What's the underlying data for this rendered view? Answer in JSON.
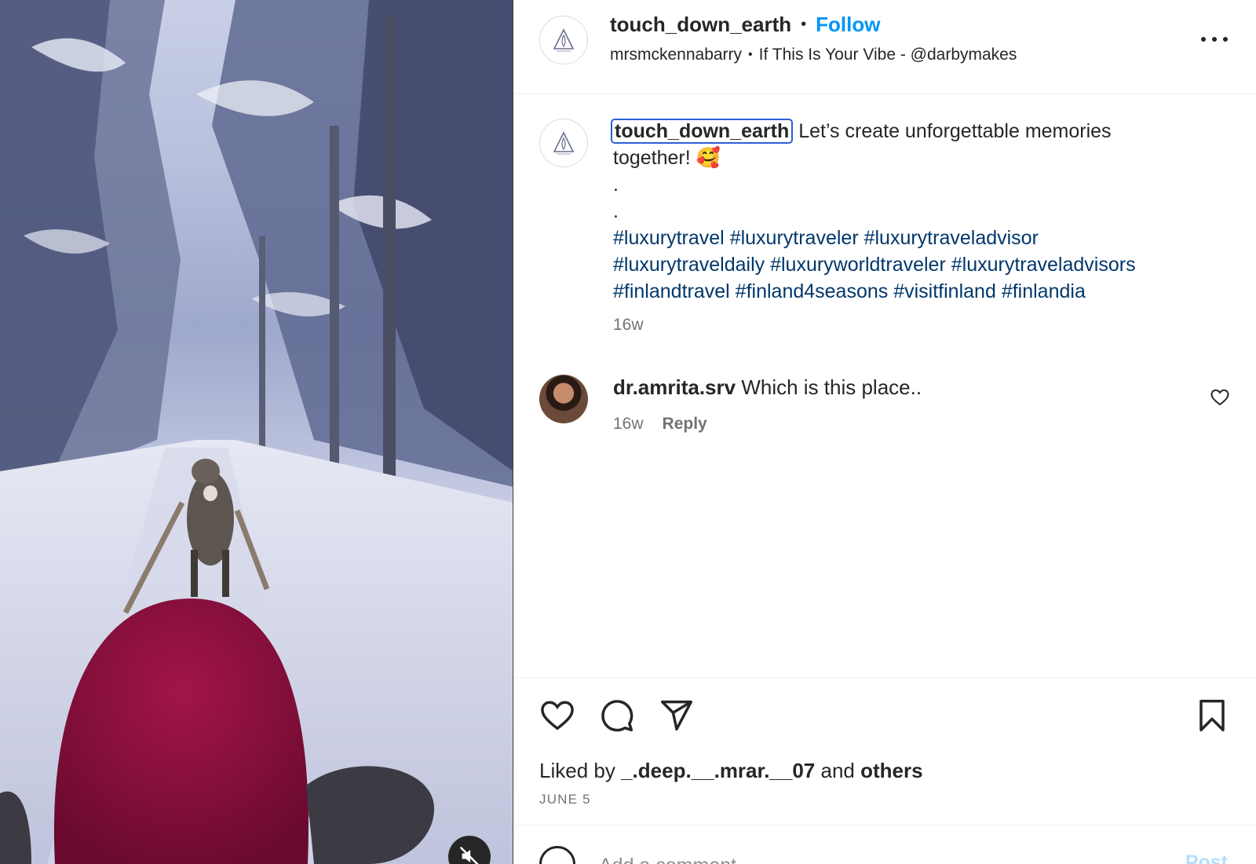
{
  "header": {
    "username": "touch_down_earth",
    "separator": "•",
    "follow_label": "Follow",
    "audio_user": "mrsmckennabarry",
    "audio_separator": "•",
    "audio_track": "If This Is Your Vibe - @darbymakes",
    "avatar_icon": "triangle-logo-icon",
    "more_icon": "more-options-icon"
  },
  "caption": {
    "username": "touch_down_earth",
    "text_line1": " Let’s create unforgettable memories",
    "text_line2": "together! 🥰",
    "dot1": ".",
    "dot2": ".",
    "hashtags": [
      "#luxurytravel",
      "#luxurytraveler",
      "#luxurytraveladvisor",
      "#luxurytraveldaily",
      "#luxuryworldtraveler",
      "#luxurytraveladvisors",
      "#finlandtravel",
      "#finland4seasons",
      "#visitfinland",
      "#finlandia"
    ],
    "time": "16w"
  },
  "comment": {
    "username": "dr.amrita.srv",
    "text": "Which is this place..",
    "time": "16w",
    "reply_label": "Reply",
    "like_icon": "heart-icon"
  },
  "actions": {
    "like_icon": "heart-icon",
    "comment_icon": "comment-bubble-icon",
    "share_icon": "paper-plane-icon",
    "save_icon": "bookmark-icon"
  },
  "likes": {
    "prefix": "Liked by",
    "user": "_.deep.__.mrar.__07",
    "middle": "and",
    "others": "others"
  },
  "post_date": "JUNE 5",
  "add_comment": {
    "placeholder": "Add a comment...",
    "post_label": "Post",
    "emoji_icon": "emoji-icon"
  },
  "media": {
    "mute_icon": "muted-speaker-icon"
  },
  "colors": {
    "accent": "#0095f6",
    "hashtag": "#00376b",
    "text": "#262626",
    "secondary": "#737373",
    "highlight_border": "#2c5fd6"
  }
}
